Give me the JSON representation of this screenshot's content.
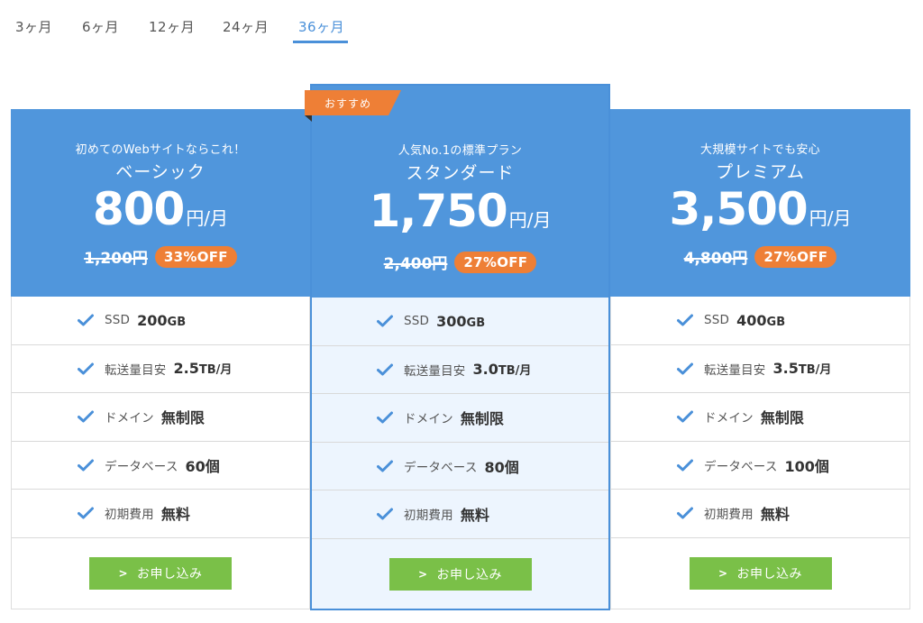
{
  "tabs": [
    {
      "label": "3ヶ月",
      "active": false
    },
    {
      "label": "6ヶ月",
      "active": false
    },
    {
      "label": "12ヶ月",
      "active": false
    },
    {
      "label": "24ヶ月",
      "active": false
    },
    {
      "label": "36ヶ月",
      "active": true
    }
  ],
  "colors": {
    "accent": "#4a90d9",
    "header": "#5096dc",
    "badge": "#ee7f36",
    "cta": "#7ac048",
    "highlight_bg": "#edf5fe"
  },
  "recommend_label": "おすすめ",
  "plans": [
    {
      "tagline": "初めてのWebサイトならこれ！",
      "name": "ベーシック",
      "price": "800",
      "price_unit": "円/月",
      "old_price": "1,200円",
      "discount": "33%OFF",
      "features": [
        {
          "label": "SSD",
          "value": "200",
          "unit": "GB"
        },
        {
          "label": "転送量目安",
          "value": "2.5",
          "unit": "TB/月"
        },
        {
          "label": "ドメイン",
          "value": "無制限",
          "unit": ""
        },
        {
          "label": "データベース",
          "value": "60個",
          "unit": ""
        },
        {
          "label": "初期費用",
          "value": "無料",
          "unit": ""
        }
      ],
      "cta": "お申し込み"
    },
    {
      "tagline": "人気No.1の標準プラン",
      "name": "スタンダード",
      "price": "1,750",
      "price_unit": "円/月",
      "old_price": "2,400円",
      "discount": "27%OFF",
      "features": [
        {
          "label": "SSD",
          "value": "300",
          "unit": "GB"
        },
        {
          "label": "転送量目安",
          "value": "3.0",
          "unit": "TB/月"
        },
        {
          "label": "ドメイン",
          "value": "無制限",
          "unit": ""
        },
        {
          "label": "データベース",
          "value": "80個",
          "unit": ""
        },
        {
          "label": "初期費用",
          "value": "無料",
          "unit": ""
        }
      ],
      "cta": "お申し込み"
    },
    {
      "tagline": "大規模サイトでも安心",
      "name": "プレミアム",
      "price": "3,500",
      "price_unit": "円/月",
      "old_price": "4,800円",
      "discount": "27%OFF",
      "features": [
        {
          "label": "SSD",
          "value": "400",
          "unit": "GB"
        },
        {
          "label": "転送量目安",
          "value": "3.5",
          "unit": "TB/月"
        },
        {
          "label": "ドメイン",
          "value": "無制限",
          "unit": ""
        },
        {
          "label": "データベース",
          "value": "100個",
          "unit": ""
        },
        {
          "label": "初期費用",
          "value": "無料",
          "unit": ""
        }
      ],
      "cta": "お申し込み"
    }
  ]
}
